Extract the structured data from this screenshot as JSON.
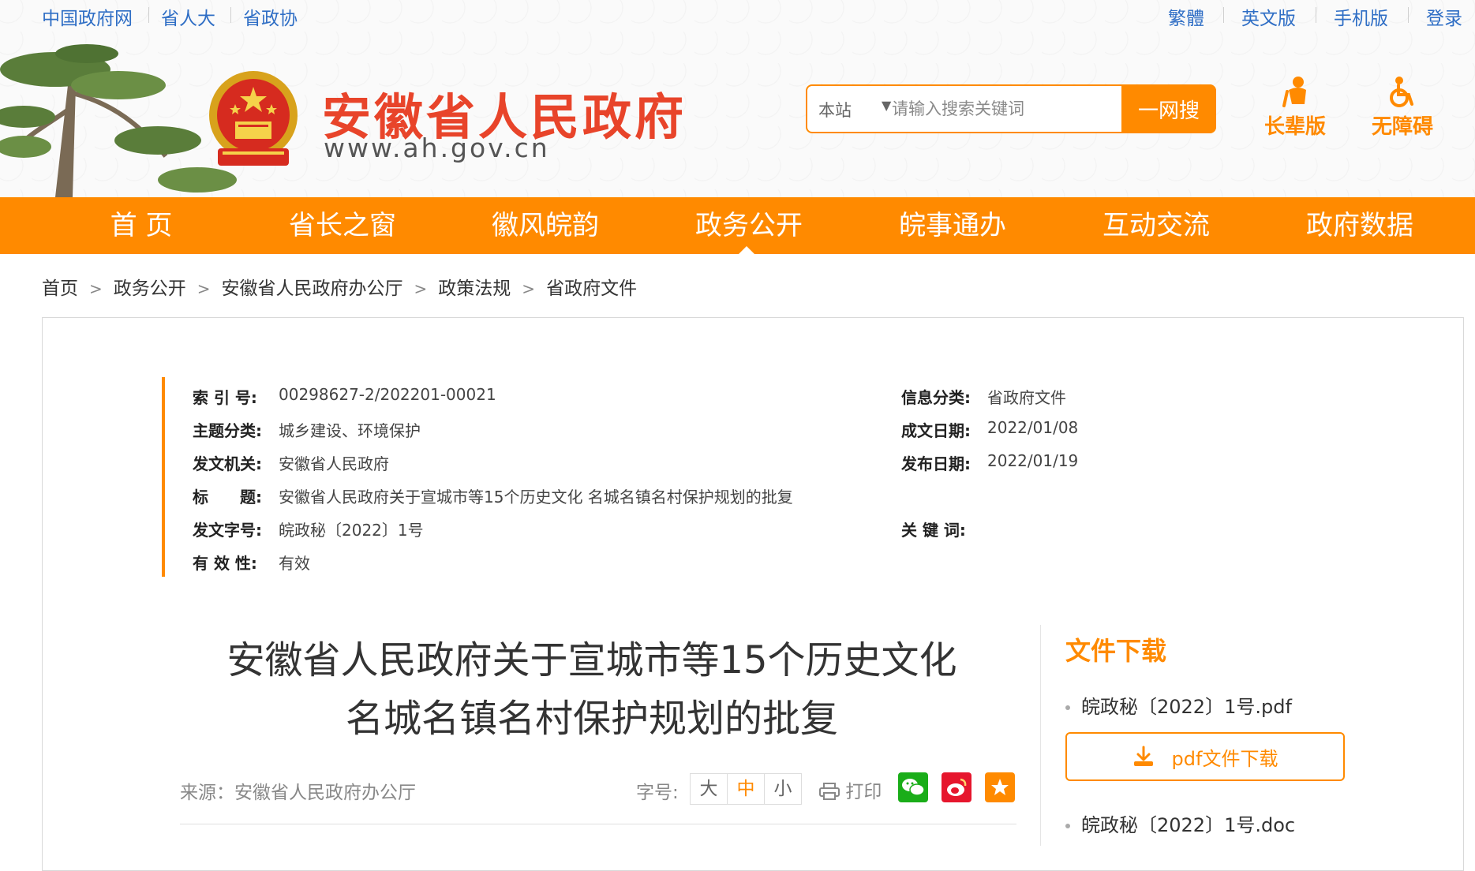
{
  "top_links": {
    "left": [
      "中国政府网",
      "省人大",
      "省政协"
    ],
    "right": [
      "繁體",
      "英文版",
      "手机版",
      "登录"
    ]
  },
  "header": {
    "site_title": "安徽省人民政府",
    "site_url": "www.ah.gov.cn",
    "search": {
      "scope": "本站",
      "placeholder": "请输入搜索关键词",
      "button_label": "一网搜"
    },
    "tools": [
      "长辈版",
      "无障碍"
    ]
  },
  "nav": {
    "items": [
      "首 页",
      "省长之窗",
      "徽风皖韵",
      "政务公开",
      "皖事通办",
      "互动交流",
      "政府数据"
    ],
    "active": "政务公开"
  },
  "breadcrumb": [
    "首页",
    "政务公开",
    "安徽省人民政府办公厅",
    "政策法规",
    "省政府文件"
  ],
  "meta": {
    "index_no_label": "索 引 号:",
    "index_no": "00298627-2/202201-00021",
    "category_label": "信息分类:",
    "category": "省政府文件",
    "topic_label": "主题分类:",
    "topic": "城乡建设、环境保护",
    "date_written_label": "成文日期:",
    "date_written": "2022/01/08",
    "issuer_label": "发文机关:",
    "issuer": "安徽省人民政府",
    "date_published_label": "发布日期:",
    "date_published": "2022/01/19",
    "title_label": "标　　题:",
    "title": "安徽省人民政府关于宣城市等15个历史文化 名城名镇名村保护规划的批复",
    "doc_no_label": "发文字号:",
    "doc_no": "皖政秘〔2022〕1号",
    "keywords_label": "关 键 词:",
    "keywords": "",
    "validity_label": "有 效 性:",
    "validity": "有效"
  },
  "article": {
    "title_line1": "安徽省人民政府关于宣城市等15个历史文化",
    "title_line2": "名城名镇名村保护规划的批复",
    "source": "来源：安徽省人民政府办公厅",
    "fontsize_label": "字号:",
    "fontsize_options": [
      "大",
      "中",
      "小"
    ],
    "fontsize_active": "中",
    "print_label": "打印"
  },
  "downloads": {
    "heading": "文件下载",
    "files": [
      "皖政秘〔2022〕1号.pdf",
      "皖政秘〔2022〕1号.doc"
    ],
    "pdf_button_label": "pdf文件下载"
  },
  "colors": {
    "accent": "#ff8a00",
    "title_red": "#e8442a",
    "link_blue": "#2f6ec5",
    "wechat": "#1aad19",
    "weibo": "#e6162d",
    "favorite": "#ff8a00"
  },
  "icons": [
    "tree-logo-icon",
    "national-emblem-icon",
    "elder-mode-icon",
    "accessibility-icon",
    "print-icon",
    "wechat-icon",
    "weibo-icon",
    "favorite-icon",
    "download-icon"
  ]
}
